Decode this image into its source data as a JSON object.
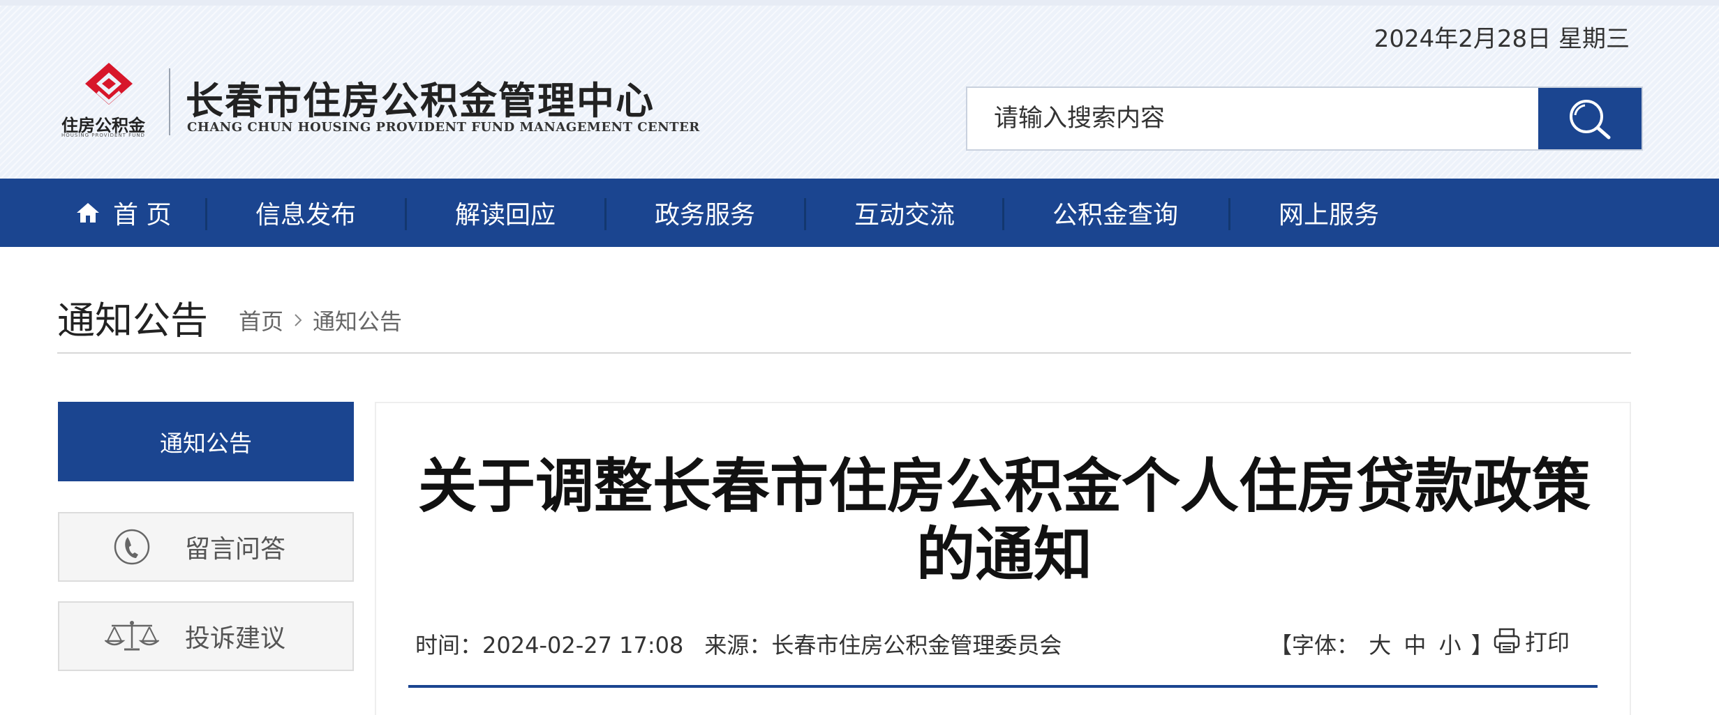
{
  "header": {
    "date": "2024年2月28日 星期三",
    "logo": {
      "mark_text": "住房公积金",
      "mark_subtext": "HOUSING PROVIDENT FUND",
      "title_cn": "长春市住房公积金管理中心",
      "title_en": "CHANG CHUN HOUSING PROVIDENT FUND MANAGEMENT CENTER"
    },
    "search": {
      "placeholder": "请输入搜索内容",
      "icon": "search-icon"
    }
  },
  "nav": {
    "items": [
      {
        "label": "首 页",
        "icon": "home-icon"
      },
      {
        "label": "信息发布"
      },
      {
        "label": "解读回应"
      },
      {
        "label": "政务服务"
      },
      {
        "label": "互动交流"
      },
      {
        "label": "公积金查询"
      },
      {
        "label": "网上服务"
      }
    ]
  },
  "page": {
    "heading": "通知公告",
    "breadcrumb": [
      "首页",
      "通知公告"
    ]
  },
  "sidebar": {
    "active": "通知公告",
    "items": [
      {
        "label": "留言问答",
        "icon": "phone-icon"
      },
      {
        "label": "投诉建议",
        "icon": "scales-icon"
      }
    ]
  },
  "article": {
    "title": "关于调整长春市住房公积金个人住房贷款政策的通知",
    "time_label": "时间：",
    "time": "2024-02-27 17:08",
    "source_label": "来源：",
    "source": "长春市住房公积金管理委员会",
    "font_open": "【字体：",
    "font_options": [
      "大",
      "中",
      "小"
    ],
    "font_close": "】",
    "print_label": "打印"
  },
  "colors": {
    "brand_blue": "#1b4590",
    "logo_red": "#d7162a"
  }
}
